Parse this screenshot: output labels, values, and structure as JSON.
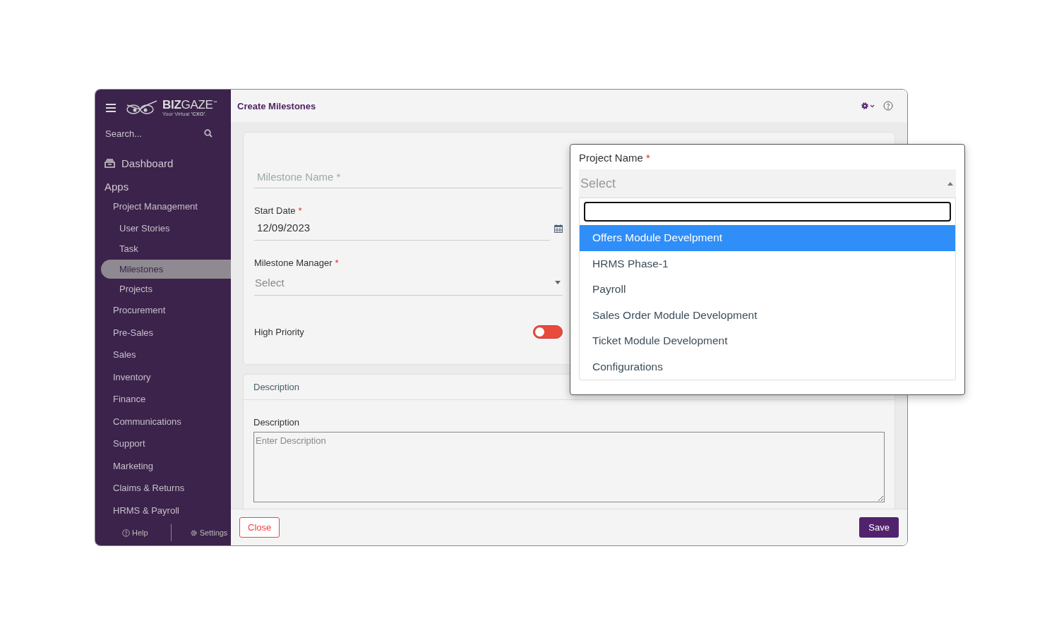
{
  "sidebar": {
    "brand": {
      "strong": "BIZ",
      "light": "GAZE",
      "tm": "™",
      "tagline": "Your Virtual **'CXO'**."
    },
    "search": {
      "placeholder": "Search..."
    },
    "dashboard": "Dashboard",
    "section": "Apps",
    "items": [
      {
        "label": "Project Management",
        "selected": false,
        "children": [
          {
            "label": "User Stories",
            "selected": false
          },
          {
            "label": "Task",
            "selected": false
          },
          {
            "label": "Milestones",
            "selected": true
          },
          {
            "label": "Projects",
            "selected": false
          }
        ]
      },
      {
        "label": "Procurement",
        "selected": false
      },
      {
        "label": "Pre-Sales",
        "selected": false
      },
      {
        "label": "Sales",
        "selected": false
      },
      {
        "label": "Inventory",
        "selected": false
      },
      {
        "label": "Finance",
        "selected": false
      },
      {
        "label": "Communications",
        "selected": false
      },
      {
        "label": "Support",
        "selected": false
      },
      {
        "label": "Marketing",
        "selected": false
      },
      {
        "label": "Claims & Returns",
        "selected": false
      },
      {
        "label": "HRMS & Payroll",
        "selected": false
      }
    ],
    "footer": {
      "help": "Help",
      "settings": "Settings"
    }
  },
  "header": {
    "title": "Create Milestones"
  },
  "form": {
    "milestone_name": {
      "placeholder": "Milestone Name *"
    },
    "start_date": {
      "label": "Start Date",
      "required_mark": "*",
      "value": "12/09/2023"
    },
    "milestone_manager": {
      "label": "Milestone Manager",
      "required_mark": "*",
      "placeholder": "Select"
    },
    "high_priority": {
      "label": "High Priority",
      "on": false
    }
  },
  "description_section": {
    "title": "Description",
    "label": "Description",
    "placeholder": "Enter Description"
  },
  "project_dropdown": {
    "label": "Project Name",
    "required_mark": "*",
    "placeholder": "Select",
    "options": [
      {
        "label": "Offers Module Develpment",
        "selected": true
      },
      {
        "label": "HRMS Phase-1",
        "selected": false
      },
      {
        "label": "Payroll",
        "selected": false
      },
      {
        "label": "Sales Order Module Development",
        "selected": false
      },
      {
        "label": "Ticket Module Development",
        "selected": false
      },
      {
        "label": "Configurations",
        "selected": false
      }
    ]
  },
  "footer": {
    "close": "Close",
    "save": "Save"
  }
}
